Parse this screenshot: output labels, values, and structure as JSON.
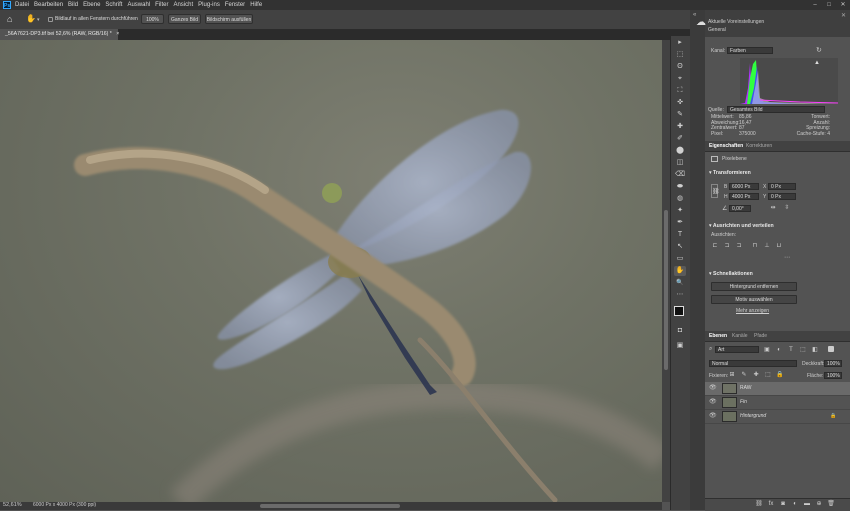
{
  "app": {
    "logo": "Ps"
  },
  "menu": [
    "Datei",
    "Bearbeiten",
    "Bild",
    "Ebene",
    "Schrift",
    "Auswahl",
    "Filter",
    "Ansicht",
    "Plug-ins",
    "Fenster",
    "Hilfe"
  ],
  "window_controls": [
    "–",
    "□",
    "✕"
  ],
  "options_bar": {
    "scroll_all_label": "Bildlauf in allen Fenstern durchführen",
    "zoom_100": "100%",
    "fit_screen": "Ganzes Bild",
    "fill_screen": "Bildschirm ausfüllen"
  },
  "document_tab": {
    "title": "_56A7621-DP3.tif bei 52,6% (RAW, RGB/16) *",
    "close": "×"
  },
  "status": {
    "zoom": "52,61%",
    "info": "6000 Px x 4000 Px (300 ppi)"
  },
  "histogram_panel": {
    "title": "Aktuelle Voreinstellungen",
    "subtitle": "General",
    "channel_label": "Kanal:",
    "channel_value": "Farben",
    "source_label": "Quelle:",
    "source_value": "Gesamtes Bild",
    "stats_left": [
      {
        "k": "Mittelwert:",
        "v": "85,86"
      },
      {
        "k": "Abweichung:",
        "v": "16,47"
      },
      {
        "k": "Zentralwert:",
        "v": "87"
      },
      {
        "k": "Pixel:",
        "v": "375000"
      }
    ],
    "stats_right": [
      {
        "k": "Tonwert:",
        "v": ""
      },
      {
        "k": "Anzahl:",
        "v": ""
      },
      {
        "k": "Spreizung:",
        "v": ""
      },
      {
        "k": "Cache-Stufe:",
        "v": "4"
      }
    ]
  },
  "properties_panel": {
    "tabs": [
      "Eigenschaften",
      "Korrekturen"
    ],
    "layer_type": "Pixelebene",
    "transform_title": "Transformieren",
    "w_label": "B",
    "w_value": "6000 Px",
    "h_label": "H",
    "h_value": "4000 Px",
    "x_label": "X",
    "x_value": "0 Px",
    "y_label": "Y",
    "y_value": "0 Px",
    "angle_value": "0,00°",
    "align_title": "Ausrichten und verteilen",
    "align_label": "Ausrichten:",
    "quick_title": "Schnellaktionen",
    "remove_bg": "Hintergrund entfernen",
    "select_subject": "Motiv auswählen",
    "more": "Mehr anzeigen"
  },
  "layers_panel": {
    "tabs": [
      "Ebenen",
      "Kanäle",
      "Pfade"
    ],
    "filter_value": "Art",
    "blend_mode": "Normal",
    "opacity_label": "Deckkraft:",
    "opacity_value": "100%",
    "lock_label": "Fixieren:",
    "fill_label": "Fläche:",
    "fill_value": "100%",
    "layers": [
      {
        "name": "RAW",
        "italic": false
      },
      {
        "name": "Fin",
        "italic": true
      },
      {
        "name": "Hintergrund",
        "italic": true
      }
    ]
  },
  "tools": [
    "▸",
    "⬚",
    "ʘ",
    "⌖",
    "⛶",
    "✜",
    "✎",
    "✚",
    "✐",
    "⬤",
    "◫",
    "⌫",
    "⬬",
    "◍",
    "✦",
    "✒",
    "T",
    "↖",
    "▭",
    "✋",
    "🔍",
    "⋯"
  ]
}
